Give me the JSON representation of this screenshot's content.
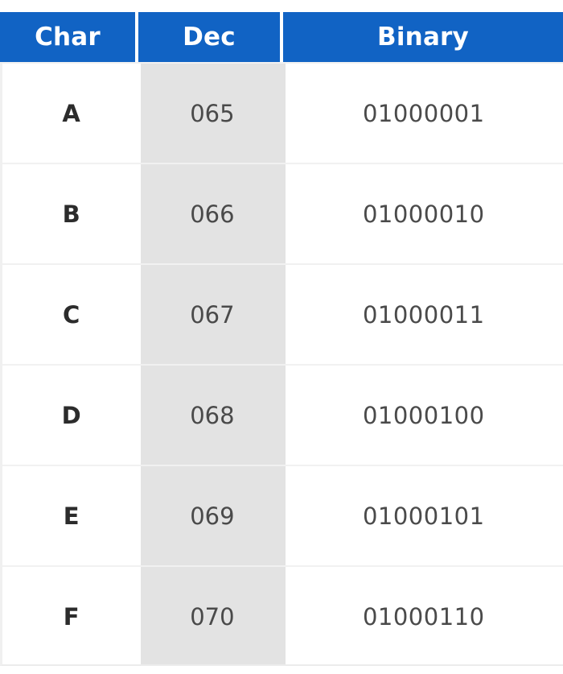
{
  "table": {
    "columns": [
      {
        "key": "char",
        "label": "Char"
      },
      {
        "key": "dec",
        "label": "Dec"
      },
      {
        "key": "binary",
        "label": "Binary"
      }
    ],
    "rows": [
      {
        "char": "A",
        "dec": "065",
        "binary": "01000001"
      },
      {
        "char": "B",
        "dec": "066",
        "binary": "01000010"
      },
      {
        "char": "C",
        "dec": "067",
        "binary": "01000011"
      },
      {
        "char": "D",
        "dec": "068",
        "binary": "01000100"
      },
      {
        "char": "E",
        "dec": "069",
        "binary": "01000101"
      },
      {
        "char": "F",
        "dec": "070",
        "binary": "01000110"
      }
    ]
  },
  "colors": {
    "header_background": "#1163c4",
    "header_text": "#ffffff",
    "highlight_column_background": "#e3e3e3",
    "row_divider": "#f1f1f1",
    "body_text": "#4a4a4a",
    "char_text": "#2c2c2c"
  }
}
